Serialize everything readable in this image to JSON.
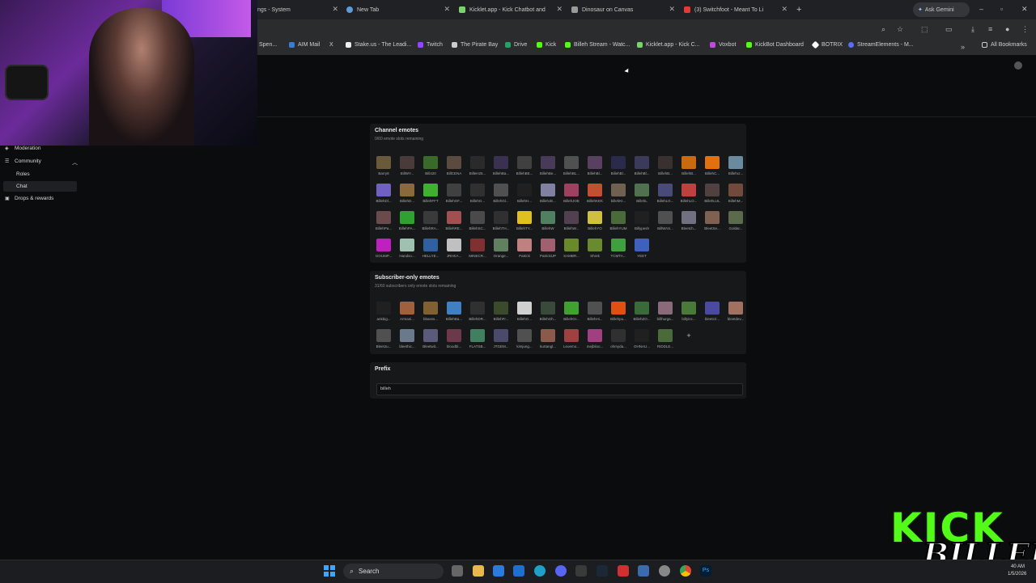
{
  "browser": {
    "tabs": [
      {
        "label": "ngs - System",
        "color": "#888888"
      },
      {
        "label": "New Tab",
        "color": "#5f9bd6"
      },
      {
        "label": "Kicklet.app - Kick Chatbot and",
        "color": "#7ad36b"
      },
      {
        "label": "Dinosaur on Canvas",
        "color": "#9a9a9a"
      },
      {
        "label": "(3) Switchfoot - Meant To Li",
        "color": "#e53935"
      }
    ],
    "ask_gemini": "Ask Gemini",
    "bookmarks": [
      {
        "label": "Spen...",
        "color": "#888"
      },
      {
        "label": "AIM Mail",
        "color": "#3a7bd5"
      },
      {
        "label": "X",
        "color": "#ddd"
      },
      {
        "label": "Stake.us - The Leadi...",
        "color": "#fff"
      },
      {
        "label": "Twitch",
        "color": "#9146ff"
      },
      {
        "label": "The Pirate Bay",
        "color": "#ccc"
      },
      {
        "label": "Drive",
        "color": "#1fa463"
      },
      {
        "label": "Kick",
        "color": "#53fc18"
      },
      {
        "label": "Billeh Stream - Watc...",
        "color": "#53fc18"
      },
      {
        "label": "Kicklet.app - Kick C...",
        "color": "#7ad36b"
      },
      {
        "label": "Voxbot",
        "color": "#c04ae0"
      },
      {
        "label": "KickBot Dashboard",
        "color": "#53fc18"
      },
      {
        "label": "BOTRIX",
        "color": "#fff"
      },
      {
        "label": "StreamElements - M...",
        "color": "#5b6cff"
      }
    ],
    "all_bookmarks": "All Bookmarks"
  },
  "sidebar": {
    "items": [
      {
        "label": "Moderation",
        "icon": "shield-icon"
      },
      {
        "label": "Community",
        "icon": "community-icon",
        "chevron": "^"
      },
      {
        "label": "Roles"
      },
      {
        "label": "Chat"
      },
      {
        "label": "Drops & rewards",
        "icon": "gift-icon"
      }
    ]
  },
  "channel_emotes": {
    "title": "Channel emotes",
    "subtitle": "0/60 emote slots remaining",
    "rows": [
      [
        [
          "Barry8",
          "#6b5a3a"
        ],
        [
          "BillWY...",
          "#4a3a3a"
        ],
        [
          "Bill420",
          "#3a6a2a"
        ],
        [
          "BillCENA",
          "#5a4a40"
        ],
        [
          "BilleH25...",
          "#2a2a2a"
        ],
        [
          "BillehBa...",
          "#3a3050"
        ],
        [
          "BillehBE...",
          "#404040"
        ],
        [
          "BillehBe...",
          "#4a3a5a"
        ],
        [
          "BillehBL...",
          "#505050"
        ],
        [
          "BillehBl...",
          "#5a4060"
        ],
        [
          "BillehBl...",
          "#2a2a4a"
        ],
        [
          "BillehBl...",
          "#3a3a5a"
        ],
        [
          "BillehB...",
          "#3a3030"
        ],
        [
          "BillehB...",
          "#c96a10"
        ],
        [
          "BillehC...",
          "#e07010"
        ],
        [
          "Billehcr...",
          "#6a8aa0"
        ]
      ],
      [
        [
          "BillehDl...",
          "#7060c0"
        ],
        [
          "BillehD...",
          "#8a6a3a"
        ],
        [
          "BillehFFT",
          "#40b030"
        ],
        [
          "BillehGF...",
          "#404040"
        ],
        [
          "BillehG...",
          "#303030"
        ],
        [
          "BillehGl...",
          "#505050"
        ],
        [
          "BillehH...",
          "#202020"
        ],
        [
          "BillehJE...",
          "#8080a0"
        ],
        [
          "BillehJOE",
          "#a04060"
        ],
        [
          "BillehKEK",
          "#c05030"
        ],
        [
          "billehKI...",
          "#706050"
        ],
        [
          "BillehL",
          "#507050"
        ],
        [
          "BillehLG...",
          "#4a4a7a"
        ],
        [
          "BillehLO...",
          "#c04040"
        ],
        [
          "BillehLUL",
          "#504040"
        ],
        [
          "BillehM...",
          "#704a3a"
        ]
      ],
      [
        [
          "BillehPa...",
          "#6a4a4a"
        ],
        [
          "BillehPA...",
          "#30a030"
        ],
        [
          "BillehRA...",
          "#3a3a3a"
        ],
        [
          "BillehRE...",
          "#a05050"
        ],
        [
          "BillehSC...",
          "#4a4a4a"
        ],
        [
          "BillehTH...",
          "#303030"
        ],
        [
          "BillehTY...",
          "#e0c020"
        ],
        [
          "BillehW",
          "#508060"
        ],
        [
          "BillehW...",
          "#504050"
        ],
        [
          "BillehYO",
          "#d0c040"
        ],
        [
          "BillehYUM",
          "#4a6a3a"
        ],
        [
          "Billypesh",
          "#202020"
        ],
        [
          "BillWAS...",
          "#505050"
        ],
        [
          "Bleetch...",
          "#707080"
        ],
        [
          "BleetSe...",
          "#806050"
        ],
        [
          "Goldar...",
          "#5a6a4a"
        ]
      ],
      [
        [
          "GOUMP...",
          "#c020c0"
        ],
        [
          "Handso...",
          "#a0c0b0"
        ],
        [
          "HELLYE...",
          "#3060a0"
        ],
        [
          "JRHKA...",
          "#c0c0c0"
        ],
        [
          "MINECR...",
          "#803030"
        ],
        [
          "Orange...",
          "#608060"
        ],
        [
          "Patrick",
          "#c08080"
        ],
        [
          "PatrickUP",
          "#a06070"
        ],
        [
          "SAMBR...",
          "#6a8a2a"
        ],
        [
          "Shrek",
          "#6a8a30"
        ],
        [
          "TCMTA...",
          "#40a040"
        ],
        [
          "YEET",
          "#4060c0"
        ]
      ]
    ]
  },
  "subscriber_emotes": {
    "title": "Subscriber-only emotes",
    "subtitle": "31/60 subscribers only emote slots remaining",
    "rows": [
      [
        [
          "ankbig...",
          "#202020"
        ],
        [
          "Armani...",
          "#a06040"
        ],
        [
          "bbasss...",
          "#806030"
        ],
        [
          "BillehBa...",
          "#4080c0"
        ],
        [
          "BillehDR...",
          "#303030"
        ],
        [
          "BillehFr...",
          "#3a4a2a"
        ],
        [
          "BillehG...",
          "#d0d0d0"
        ],
        [
          "BillehGh...",
          "#3a4a3a"
        ],
        [
          "BillehGr...",
          "#40a030"
        ],
        [
          "BillehHi...",
          "#505050"
        ],
        [
          "Billehpu...",
          "#e05010"
        ],
        [
          "BillehZO...",
          "#3a6a3a"
        ],
        [
          "billhurga...",
          "#8a6a7a"
        ],
        [
          "billyinc...",
          "#4a7a3a"
        ],
        [
          "bleetcri...",
          "#4a4aa0"
        ],
        [
          "bleetdev...",
          "#a07060"
        ]
      ],
      [
        [
          "BleetJu...",
          "#505050"
        ],
        [
          "bleethic...",
          "#6a7a8a"
        ],
        [
          "Bleetwit...",
          "#5a5a7a"
        ],
        [
          "bloodbl...",
          "#6a3a4a"
        ],
        [
          "FLATSB...",
          "#408060"
        ],
        [
          "JTGEM...",
          "#4a4a6a"
        ],
        [
          "kimjung...",
          "#505050"
        ],
        [
          "kurtangl...",
          "#8a5a4a"
        ],
        [
          "Leoemo...",
          "#a04040"
        ],
        [
          "mejbiloo...",
          "#a04080"
        ],
        [
          "ohmyda...",
          "#303030"
        ],
        [
          "OHNAU...",
          "#202020"
        ],
        [
          "RIDDLE...",
          "#4a6a3a"
        ],
        [
          "+",
          "#17181a"
        ]
      ]
    ]
  },
  "prefix": {
    "title": "Prefix",
    "value": "billeh"
  },
  "taskbar": {
    "search": "Search"
  },
  "overlay": {
    "kick_text": "KICK",
    "billeh_text": "BILLEH"
  },
  "clock": {
    "time": "40 AM",
    "date": "1/5/2026"
  }
}
